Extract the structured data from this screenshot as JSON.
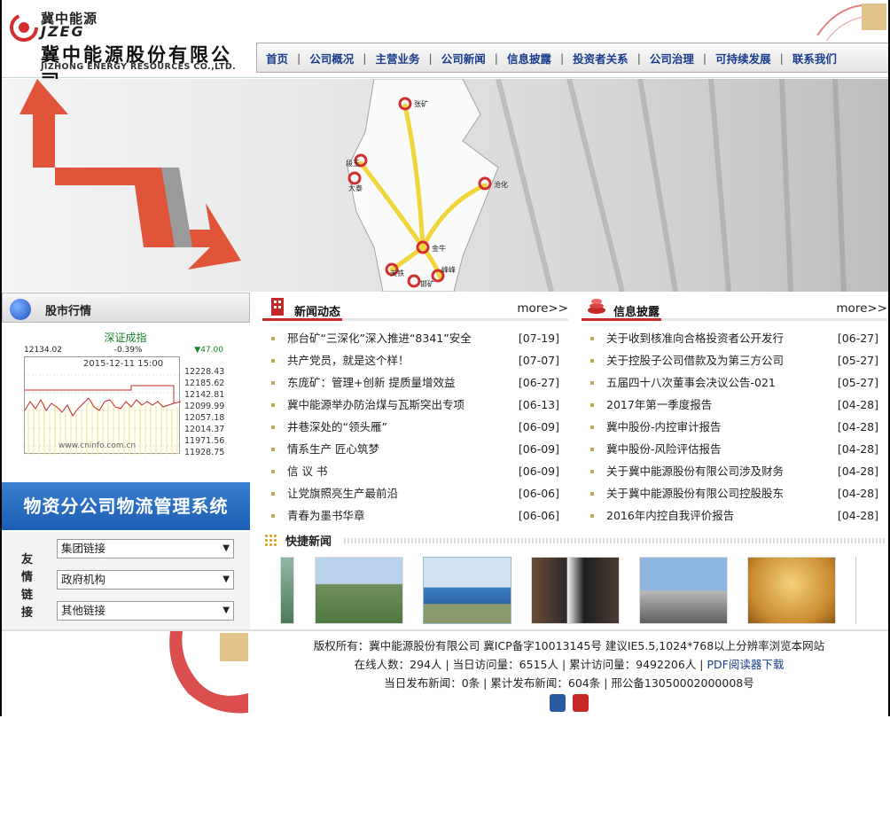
{
  "logo": {
    "cn_small": "冀中能源",
    "en_small": "JZEG",
    "cn_big": "冀中能源股份有限公司",
    "en_big": "JIZHONG ENERGY RESOURCES CO.,LTD."
  },
  "nav": [
    "首页",
    "公司概况",
    "主营业务",
    "公司新闻",
    "信息披露",
    "投资者关系",
    "公司治理",
    "可持续发展",
    "联系我们"
  ],
  "banner": {
    "labels": [
      "张矿",
      "段王",
      "大泰",
      "沧化",
      "金牛",
      "天铁",
      "邯矿",
      "峰峰"
    ]
  },
  "stock": {
    "title": "股市行情",
    "index_name": "深证成指",
    "prev_close": "12134.02",
    "change_pct": "-0.39%",
    "change": "▼47.00",
    "datetime": "2015-12-11 15:00",
    "watermark": "www.cninfo.com.cn",
    "y_labels": [
      "12228.43",
      "12185.62",
      "12142.81",
      "12099.99",
      "12057.18",
      "12014.37",
      "11971.56",
      "11928.75"
    ]
  },
  "logistics_banner": "物资分公司物流管理系统",
  "links": {
    "label": "友情链接",
    "options": [
      "集团链接",
      "政府机构",
      "其他链接"
    ]
  },
  "news": {
    "title": "新闻动态",
    "more": "more>>",
    "items": [
      {
        "t": "邢台矿“三深化”深入推进“8341”安全",
        "d": "[07-19]"
      },
      {
        "t": "共产党员，就是这个样！",
        "d": "[07-07]"
      },
      {
        "t": "东庞矿：管理+创新 提质量增效益",
        "d": "[06-27]"
      },
      {
        "t": "冀中能源举办防治煤与瓦斯突出专项",
        "d": "[06-13]"
      },
      {
        "t": "井巷深处的“领头雁”",
        "d": "[06-09]"
      },
      {
        "t": "情系生产 匠心筑梦",
        "d": "[06-09]"
      },
      {
        "t": "信 议 书",
        "d": "[06-09]"
      },
      {
        "t": "让党旗照亮生产最前沿",
        "d": "[06-06]"
      },
      {
        "t": "青春为墨书华章",
        "d": "[06-06]"
      }
    ]
  },
  "info": {
    "title": "信息披露",
    "more": "more>>",
    "items": [
      {
        "t": "关于收到核准向合格投资者公开发行",
        "d": "[06-27]"
      },
      {
        "t": "关于控股子公司借款及为第三方公司",
        "d": "[05-27]"
      },
      {
        "t": "五届四十八次董事会决议公告-021",
        "d": "[05-27]"
      },
      {
        "t": "2017年第一季度报告",
        "d": "[04-28]"
      },
      {
        "t": "冀中股份-内控审计报告",
        "d": "[04-28]"
      },
      {
        "t": "冀中股份-风险评估报告",
        "d": "[04-28]"
      },
      {
        "t": "关于冀中能源股份有限公司涉及财务",
        "d": "[04-28]"
      },
      {
        "t": "关于冀中能源股份有限公司控股股东",
        "d": "[04-28]"
      },
      {
        "t": "2016年内控自我评价报告",
        "d": "[04-28]"
      }
    ]
  },
  "quick": {
    "title": "快捷新闻"
  },
  "footer": {
    "line1": "版权所有：冀中能源股份有限公司 冀ICP备字10013145号 建议IE5.5,1024*768以上分辨率浏览本网站",
    "line2_pre": "在线人数：294人 | 当日访问量：6515人 | 累计访问量：9492206人 | ",
    "line2_link": "PDF阅读器下载",
    "line3": "当日发布新闻：0条 | 累计发布新闻：604条 | 邢公备13050002000008号"
  }
}
